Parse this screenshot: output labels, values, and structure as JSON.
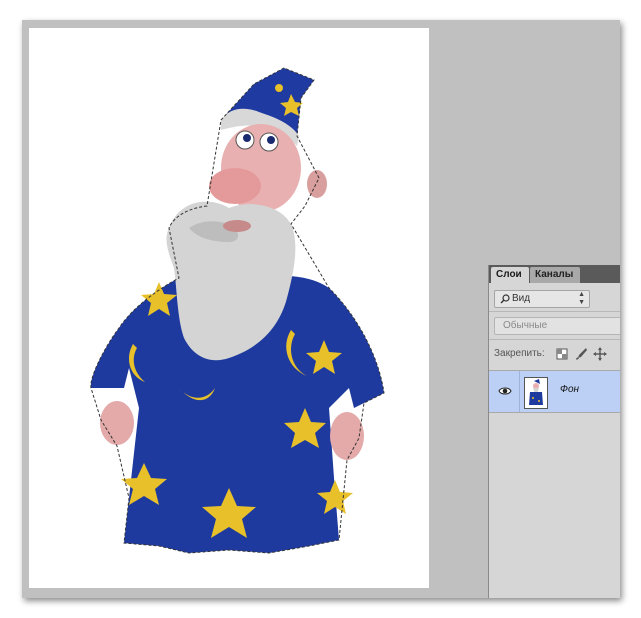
{
  "layers_panel": {
    "tabs": [
      {
        "label": "Слои",
        "active": true
      },
      {
        "label": "Каналы",
        "active": false
      }
    ],
    "filter": {
      "label": "Вид",
      "icon": "search-icon"
    },
    "blend_mode": {
      "label": "Обычные"
    },
    "lock": {
      "label": "Закрепить:",
      "icons": [
        "lock-transparent-pixels-icon",
        "lock-image-pixels-icon",
        "lock-position-icon"
      ]
    },
    "layers": [
      {
        "name": "Фон",
        "visible": true,
        "selected": true
      }
    ]
  },
  "colors": {
    "workspace": "#c0c0c0",
    "panel": "#d6d6d6",
    "tabbar": "#5a5a5a",
    "selected_layer": "#bcd0f5",
    "robe_blue": "#1e3a9e",
    "star_yellow": "#e8c12a"
  }
}
